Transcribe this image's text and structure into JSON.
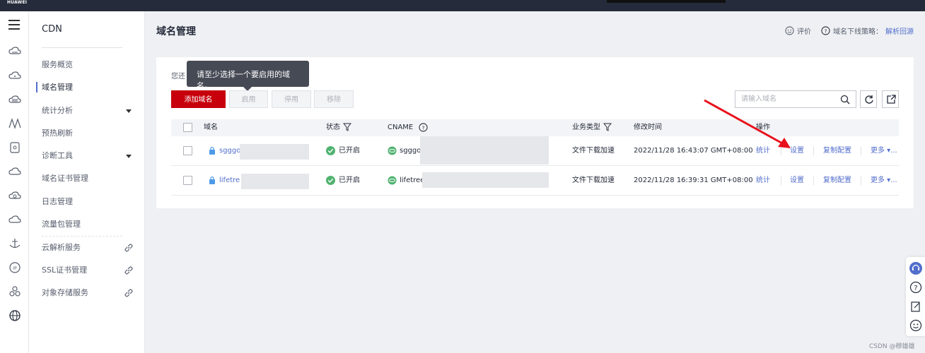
{
  "topbar": {
    "logo": "HUAWEI"
  },
  "sidebar": {
    "title": "CDN",
    "items": [
      {
        "label": "服务概览",
        "active": false
      },
      {
        "label": "域名管理",
        "active": true
      },
      {
        "label": "统计分析",
        "active": false,
        "expandable": true
      },
      {
        "label": "预热刷新",
        "active": false
      },
      {
        "label": "诊断工具",
        "active": false,
        "expandable": true
      },
      {
        "label": "域名证书管理",
        "active": false
      },
      {
        "label": "日志管理",
        "active": false
      },
      {
        "label": "流量包管理",
        "active": false
      }
    ],
    "links": [
      {
        "label": "云解析服务",
        "icon": "link-icon"
      },
      {
        "label": "SSL证书管理",
        "icon": "link-icon"
      },
      {
        "label": "对象存储服务",
        "icon": "link-icon"
      }
    ]
  },
  "page": {
    "title": "域名管理",
    "rate_label": "评价",
    "policy_label": "域名下线策略：",
    "policy_link": "解析回源"
  },
  "toolbar": {
    "hint_prefix": "您还",
    "tooltip": "请至少选择一个要启用的域名。",
    "add_label": "添加域名",
    "enable_label": "启用",
    "disable_label": "停用",
    "remove_label": "移除",
    "search_placeholder": "请输入域名"
  },
  "table": {
    "columns": {
      "domain": "域名",
      "status": "状态",
      "cname": "CNAME",
      "business_type": "业务类型",
      "modified": "修改时间",
      "ops": "操作"
    },
    "rows": [
      {
        "domain": "sgggo",
        "status": "已开启",
        "cname": "sgggo",
        "business_type": "文件下载加速",
        "modified": "2022/11/28 16:43:07 GMT+08:00",
        "ops": [
          "统计",
          "设置",
          "复制配置",
          "更多 ▾..."
        ]
      },
      {
        "domain": "lifetre",
        "status": "已开启",
        "cname": "lifetree",
        "business_type": "文件下载加速",
        "modified": "2022/11/28 16:39:31 GMT+08:00",
        "ops": [
          "统计",
          "设置",
          "复制配置",
          "更多 ▾..."
        ]
      }
    ]
  },
  "watermark": "CSDN @穆雄雄",
  "colors": {
    "primary": "#c7000b",
    "link": "#526ecc",
    "success": "#50b370",
    "annotation_arrow": "#e8111b"
  }
}
